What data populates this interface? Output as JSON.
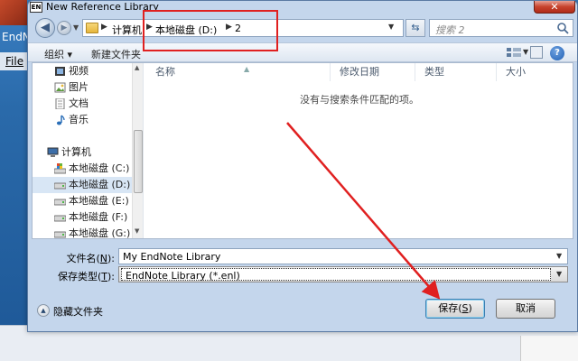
{
  "background_app": {
    "title_fragment": "EndN",
    "menu_file": "File"
  },
  "dialog": {
    "icon_text": "EN",
    "title": "New Reference Library",
    "close_symbol": "✕"
  },
  "address_bar": {
    "crumbs": [
      "计算机",
      "本地磁盘 (D:)",
      "2"
    ],
    "search_placeholder": "搜索 2"
  },
  "toolbar": {
    "organize": "组织 ▾",
    "new_folder": "新建文件夹",
    "help": "?"
  },
  "nav_tree": {
    "items": [
      {
        "label": "视频",
        "icon": "video-icon"
      },
      {
        "label": "图片",
        "icon": "picture-icon"
      },
      {
        "label": "文档",
        "icon": "document-icon"
      },
      {
        "label": "音乐",
        "icon": "music-icon"
      },
      {
        "label": "计算机",
        "icon": "computer-icon"
      },
      {
        "label": "本地磁盘 (C:)",
        "icon": "drive-icon"
      },
      {
        "label": "本地磁盘 (D:)",
        "icon": "drive-icon",
        "selected": true
      },
      {
        "label": "本地磁盘 (E:)",
        "icon": "drive-icon"
      },
      {
        "label": "本地磁盘 (F:)",
        "icon": "drive-icon"
      },
      {
        "label": "本地磁盘 (G:)",
        "icon": "drive-icon"
      }
    ]
  },
  "file_list": {
    "columns": [
      "名称",
      "修改日期",
      "类型",
      "大小"
    ],
    "empty_message": "没有与搜索条件匹配的项。"
  },
  "fields": {
    "filename_label": "文件名(",
    "filename_key": "N",
    "filename_label_end": "):",
    "filename_value": "My EndNote Library",
    "filetype_label": "保存类型(",
    "filetype_key": "T",
    "filetype_label_end": "):",
    "filetype_value": "EndNote Library (*.enl)"
  },
  "footer": {
    "hide_folders": "隐藏文件夹",
    "save_prefix": "保存(",
    "save_key": "S",
    "save_suffix": ")",
    "cancel": "取消"
  },
  "colors": {
    "annotation_red": "#e02020",
    "dialog_frame": "#c4d6ec",
    "selection": "#d8e6f5"
  }
}
